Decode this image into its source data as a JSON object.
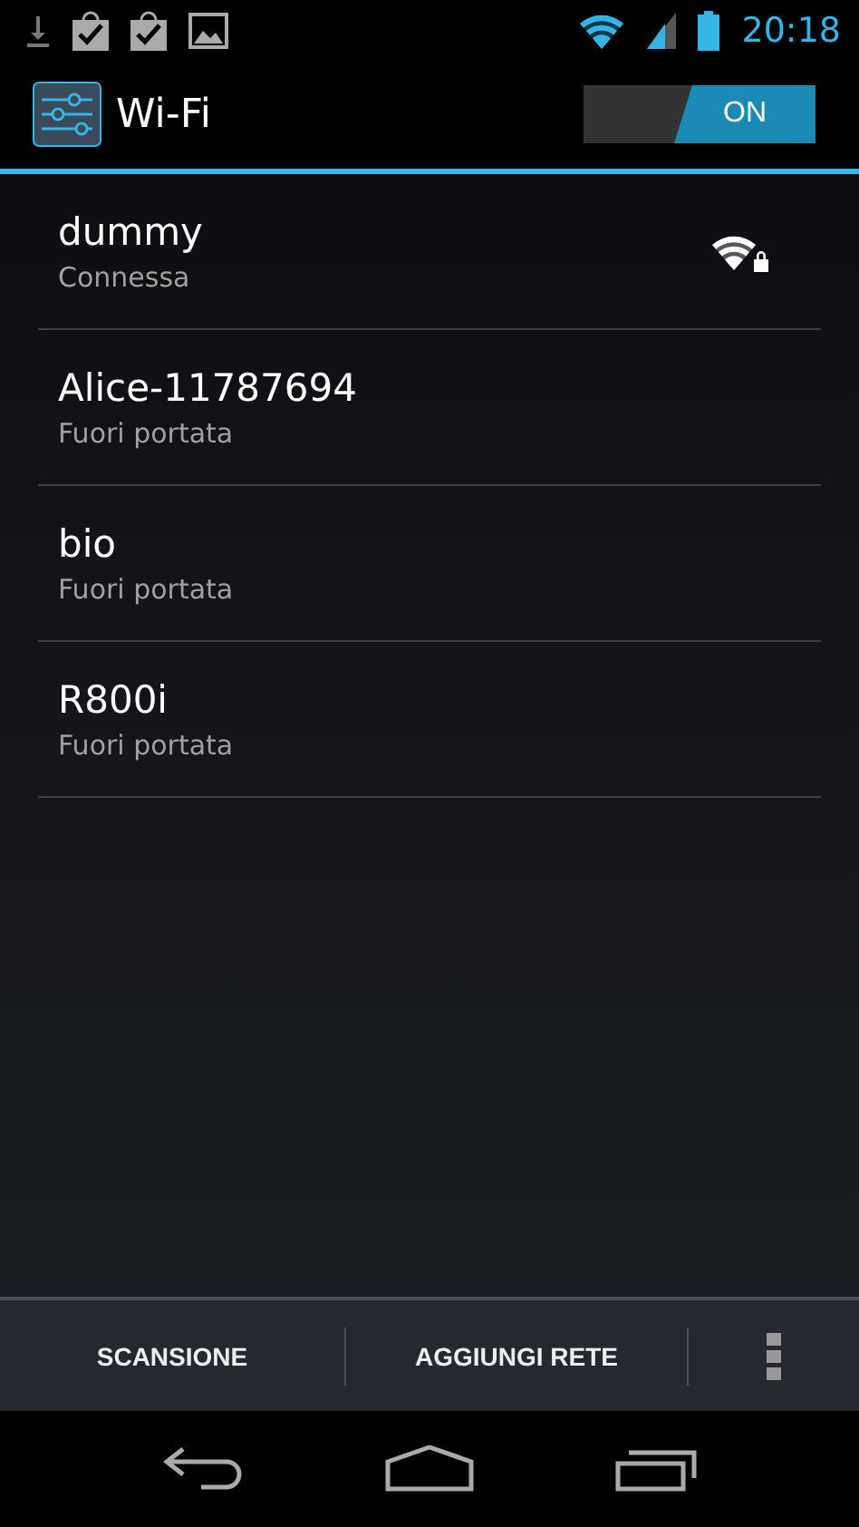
{
  "status_bar": {
    "time": "20:18"
  },
  "action_bar": {
    "title": "Wi-Fi",
    "toggle": {
      "label": "ON",
      "on": true
    }
  },
  "networks": [
    {
      "name": "dummy",
      "status": "Connessa",
      "connected": true
    },
    {
      "name": "Alice-11787694",
      "status": "Fuori portata",
      "connected": false
    },
    {
      "name": "bio",
      "status": "Fuori portata",
      "connected": false
    },
    {
      "name": "R800i",
      "status": "Fuori portata",
      "connected": false
    }
  ],
  "bottom_actions": [
    "SCANSIONE",
    "AGGIUNGI RETE"
  ]
}
